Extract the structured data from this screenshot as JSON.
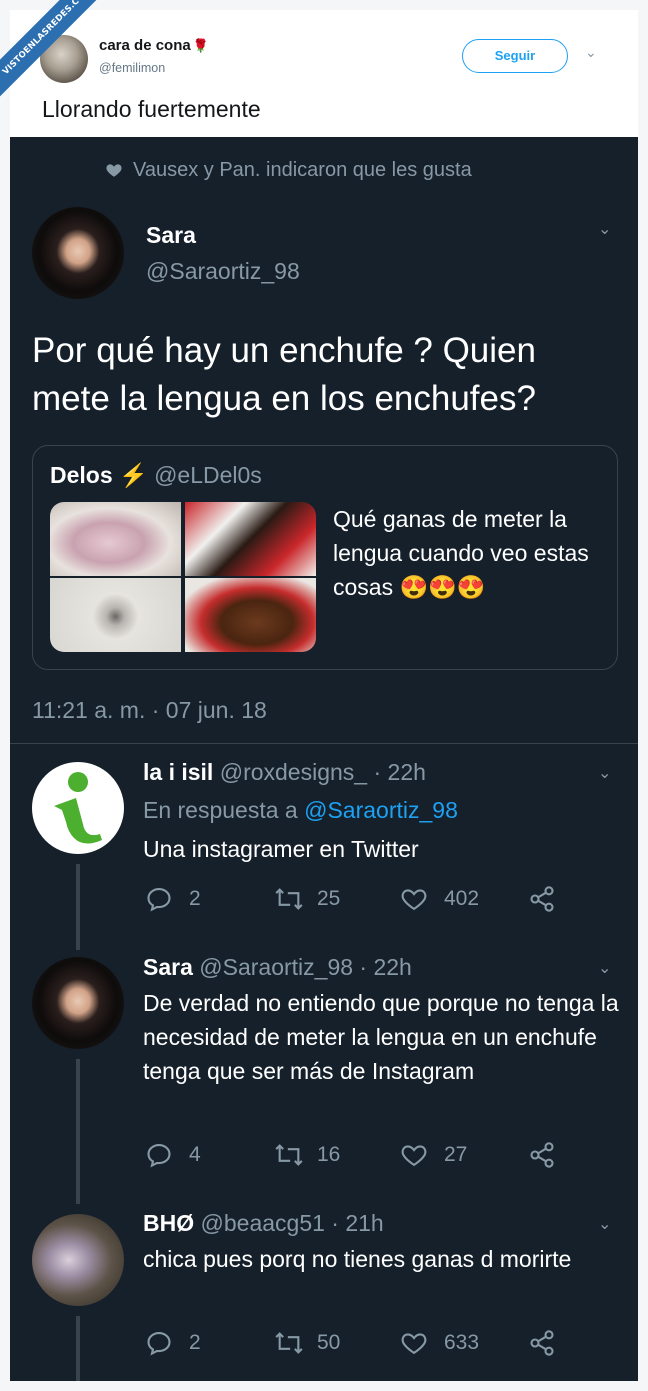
{
  "watermark": "VISTOENLASREDES.COM",
  "original_tweet": {
    "name": "cara de cona",
    "handle": "@femilimon",
    "follow_label": "Seguir",
    "text": "Llorando fuertemente"
  },
  "screenshot": {
    "liked_by": "Vausex y Pan. indicaron que les gusta",
    "main": {
      "name": "Sara",
      "handle": "@Saraortiz_98",
      "text": "Por qué hay un enchufe ? Quien mete la lengua en los enchufes?",
      "quote": {
        "name": "Delos",
        "bolt": "⚡",
        "handle": "@eLDel0s",
        "text": "Qué ganas de meter la lengua cuando veo estas cosas 😍😍😍"
      },
      "timestamp": "11:21 a. m. · 07 jun. 18"
    },
    "replies": [
      {
        "name": "la i isil",
        "handle_time": "@roxdesigns_ · 22h",
        "reply_prefix": "En respuesta a",
        "reply_to": "@Saraortiz_98",
        "text": "Una instagramer en Twitter",
        "replies": "2",
        "retweets": "25",
        "likes": "402"
      },
      {
        "name": "Sara",
        "handle_time": "@Saraortiz_98 · 22h",
        "text": "De verdad no entiendo que porque no tenga la necesidad de meter la lengua en un enchufe tenga que ser más de Instagram",
        "replies": "4",
        "retweets": "16",
        "likes": "27"
      },
      {
        "name": "BHØ",
        "handle_time": "@beaacg51 · 21h",
        "text": "chica pues porq no tienes ganas d morirte",
        "replies": "2",
        "retweets": "50",
        "likes": "633"
      }
    ]
  },
  "colors": {
    "dark_bg": "#15202b",
    "muted": "#8899a6",
    "link": "#1da1f2",
    "border": "#38444d"
  }
}
